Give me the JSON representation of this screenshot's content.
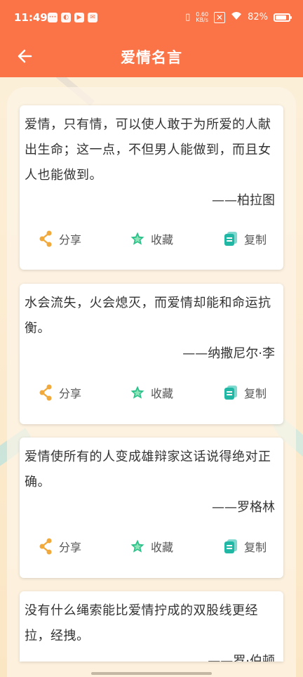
{
  "status": {
    "time": "11:49",
    "net_speed_value": "0.60",
    "net_speed_unit": "KB/s",
    "battery": "82%",
    "battery_level": 0.82
  },
  "header": {
    "title": "爱情名言"
  },
  "actions": {
    "share": "分享",
    "favorite": "收藏",
    "copy": "复制"
  },
  "quotes": [
    {
      "text": "爱情，只有情，可以使人敢于为所爱的人献出生命；这一点，不但男人能做到，而且女人也能做到。",
      "author": "——柏拉图"
    },
    {
      "text": "水会流失，火会熄灭，而爱情却能和命运抗衡。",
      "author": "——纳撒尼尔·李"
    },
    {
      "text": "爱情使所有的人变成雄辩家这话说得绝对正确。",
      "author": "——罗格林"
    },
    {
      "text": "没有什么绳索能比爱情拧成的双股线更经拉，经拽。",
      "author": "——罗·伯顿"
    }
  ],
  "colors": {
    "accent": "#fa7448",
    "share": "#f2a93b",
    "favorite": "#2bc28a",
    "copy": "#20b7a5"
  }
}
